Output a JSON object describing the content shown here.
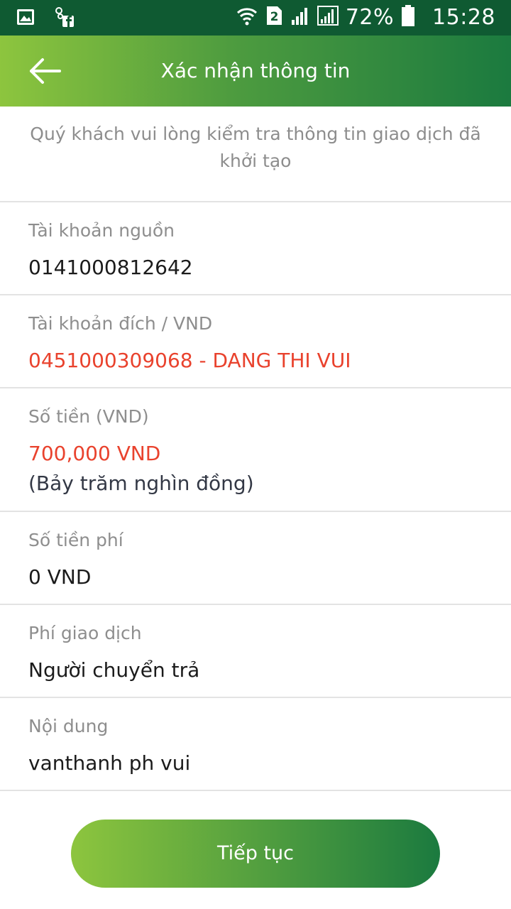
{
  "status_bar": {
    "sim_badge": "2",
    "battery_percent": "72%",
    "time": "15:28",
    "icons": [
      "gallery-icon",
      "facebook-notification-icon",
      "wifi-icon",
      "sim-2-icon",
      "signal-icon",
      "signal-alt-icon",
      "battery-icon"
    ]
  },
  "header": {
    "title": "Xác nhận thông tin",
    "back_icon": "arrow-left-icon"
  },
  "notice": "Quý khách vui lòng kiểm tra thông tin giao dịch đã khởi tạo",
  "fields": {
    "source_account": {
      "label": "Tài khoản nguồn",
      "value": "0141000812642"
    },
    "destination_account": {
      "label": "Tài khoản đích / VND",
      "value": "0451000309068 - DANG THI VUI"
    },
    "amount": {
      "label": "Số tiền (VND)",
      "value": "700,000 VND",
      "in_words": "(Bảy trăm nghìn đồng)"
    },
    "fee_amount": {
      "label": "Số tiền phí",
      "value": "0 VND"
    },
    "fee_payer": {
      "label": "Phí giao dịch",
      "value": "Người chuyển trả"
    },
    "content": {
      "label": "Nội dung",
      "value": "vanthanh ph vui"
    }
  },
  "continue_button": {
    "label": "Tiếp tục"
  },
  "colors": {
    "status_bar": "#0f5a32",
    "header_gradient_start": "#8dc53e",
    "header_gradient_end": "#1b7a3f",
    "highlight_red": "#e9422d",
    "label_gray": "#8e8e8e"
  }
}
